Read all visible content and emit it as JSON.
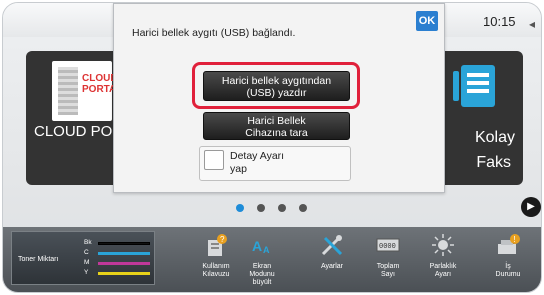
{
  "dialog": {
    "message": "Harici bellek aygıtı (USB) bağlandı.",
    "ok_label": "OK",
    "print_button": [
      "Harici bellek aygıtından",
      "(USB) yazdır"
    ],
    "scan_button": [
      "Harici Bellek",
      "Cihazına tara"
    ],
    "detail_checkbox": [
      "Detay Ayarı",
      "yap"
    ]
  },
  "status": {
    "time": "10:15"
  },
  "tiles": {
    "left": {
      "label": "CLOUD POR",
      "logo_line1": "CLOUD",
      "logo_line2": "PORTAL"
    },
    "right": {
      "label_line1": "Kolay",
      "label_line2": "Faks"
    }
  },
  "pager": {
    "count": 4,
    "active_index": 0
  },
  "toner": {
    "title": "Toner Miktarı",
    "rows": [
      {
        "name": "Bk",
        "color": "#111111",
        "level": 1.0
      },
      {
        "name": "C",
        "color": "#2aa4d8",
        "level": 1.0
      },
      {
        "name": "M",
        "color": "#c0389a",
        "level": 1.0
      },
      {
        "name": "Y",
        "color": "#e8d21a",
        "level": 1.0
      }
    ]
  },
  "bottom_bar": [
    {
      "id": "guide",
      "icon": "help-book-icon",
      "lines": [
        "Kullanım",
        "Kılavuzu"
      ]
    },
    {
      "id": "magnify",
      "icon": "text-size-icon",
      "lines": [
        "Ekran",
        "Modunu",
        "büyült"
      ]
    },
    {
      "id": "settings",
      "icon": "tools-icon",
      "lines": [
        "Ayarlar"
      ]
    },
    {
      "id": "counter",
      "icon": "counter-icon",
      "lines": [
        "Toplam",
        "Sayı"
      ]
    },
    {
      "id": "brightness",
      "icon": "brightness-icon",
      "lines": [
        "Parlaklık",
        "Ayarı"
      ]
    },
    {
      "id": "job",
      "icon": "job-status-icon",
      "lines": [
        "İş",
        "Durumu"
      ]
    }
  ],
  "colors": {
    "ok_blue": "#2b7fd0",
    "highlight_red": "#e0203a",
    "active_dot": "#1e8cd8"
  }
}
